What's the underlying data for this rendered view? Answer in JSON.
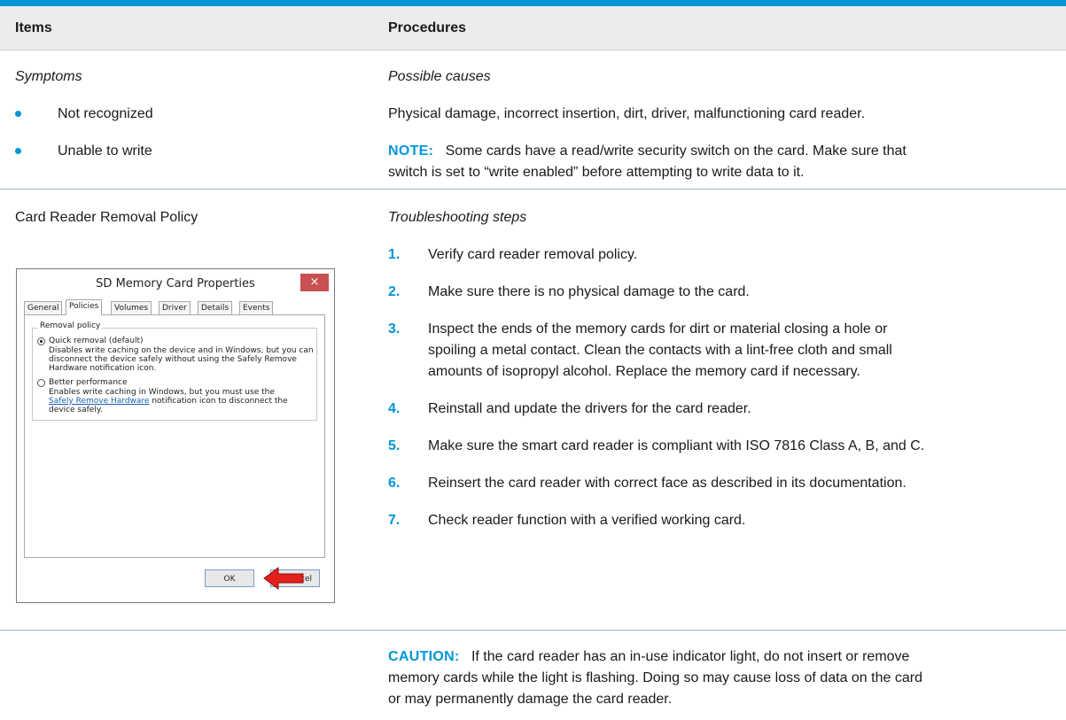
{
  "header": {
    "col1": "Items",
    "col2": "Procedures"
  },
  "row1": {
    "left_heading": "Symptoms",
    "right_heading": "Possible causes",
    "symptoms": [
      "Not recognized",
      "Unable to write"
    ],
    "causes": "Physical damage, incorrect insertion, dirt, driver, malfunctioning card reader.",
    "note_label": "NOTE:",
    "note_line1": "Some cards have a read/write security switch on the card. Make sure that",
    "note_line2": "switch is set to “write enabled” before attempting to write data to it."
  },
  "row2": {
    "left_heading": "Card Reader Removal Policy",
    "right_heading": "Troubleshooting steps",
    "steps": [
      {
        "num": "1.",
        "lines": [
          "Verify card reader removal policy."
        ]
      },
      {
        "num": "2.",
        "lines": [
          "Make sure there is no physical damage to the card."
        ]
      },
      {
        "num": "3.",
        "lines": [
          "Inspect the ends of the memory cards for dirt or material closing a hole or",
          "spoiling a metal contact. Clean the contacts with a lint-free cloth and small",
          "amounts of isopropyl alcohol. Replace the memory card if necessary."
        ]
      },
      {
        "num": "4.",
        "lines": [
          "Reinstall and update the drivers for the card reader."
        ]
      },
      {
        "num": "5.",
        "lines": [
          "Make sure the smart card reader is compliant with ISO 7816 Class A, B, and C."
        ]
      },
      {
        "num": "6.",
        "lines": [
          "Reinsert the card reader with correct face as described in its documentation."
        ]
      },
      {
        "num": "7.",
        "lines": [
          "Check reader function with a verified working card."
        ]
      }
    ]
  },
  "dialog": {
    "title": "SD Memory Card Properties",
    "close_glyph": "×",
    "tabs": [
      "General",
      "Policies",
      "Volumes",
      "Driver",
      "Details",
      "Events"
    ],
    "selected_tab": "Policies",
    "group_title": "Removal policy",
    "option1_label": "Quick removal (default)",
    "option1_desc": [
      "Disables write caching on the device and in Windows, but you can",
      "disconnect the device safely without using the Safely Remove",
      "Hardware notification icon."
    ],
    "option2_label": "Better performance",
    "option2_desc_1": "Enables write caching in Windows, but you must use the",
    "option2_link": "Safely Remove Hardware",
    "option2_desc_2": "notification icon to disconnect the",
    "option2_desc_3": "device safely.",
    "ok_label": "OK",
    "cancel_label_visible": "cel",
    "arrow_icon": "red-arrow-icon",
    "arrow_color": "#e3201b"
  },
  "caution": {
    "label": "CAUTION:",
    "lines": [
      "If the card reader has an in-use indicator light, do not insert or remove",
      "memory cards while the light is flashing. Doing so may cause loss of data on the card",
      "or may permanently damage the card reader."
    ]
  },
  "colors": {
    "accent": "#0096d6",
    "header_bg": "#ececec"
  }
}
